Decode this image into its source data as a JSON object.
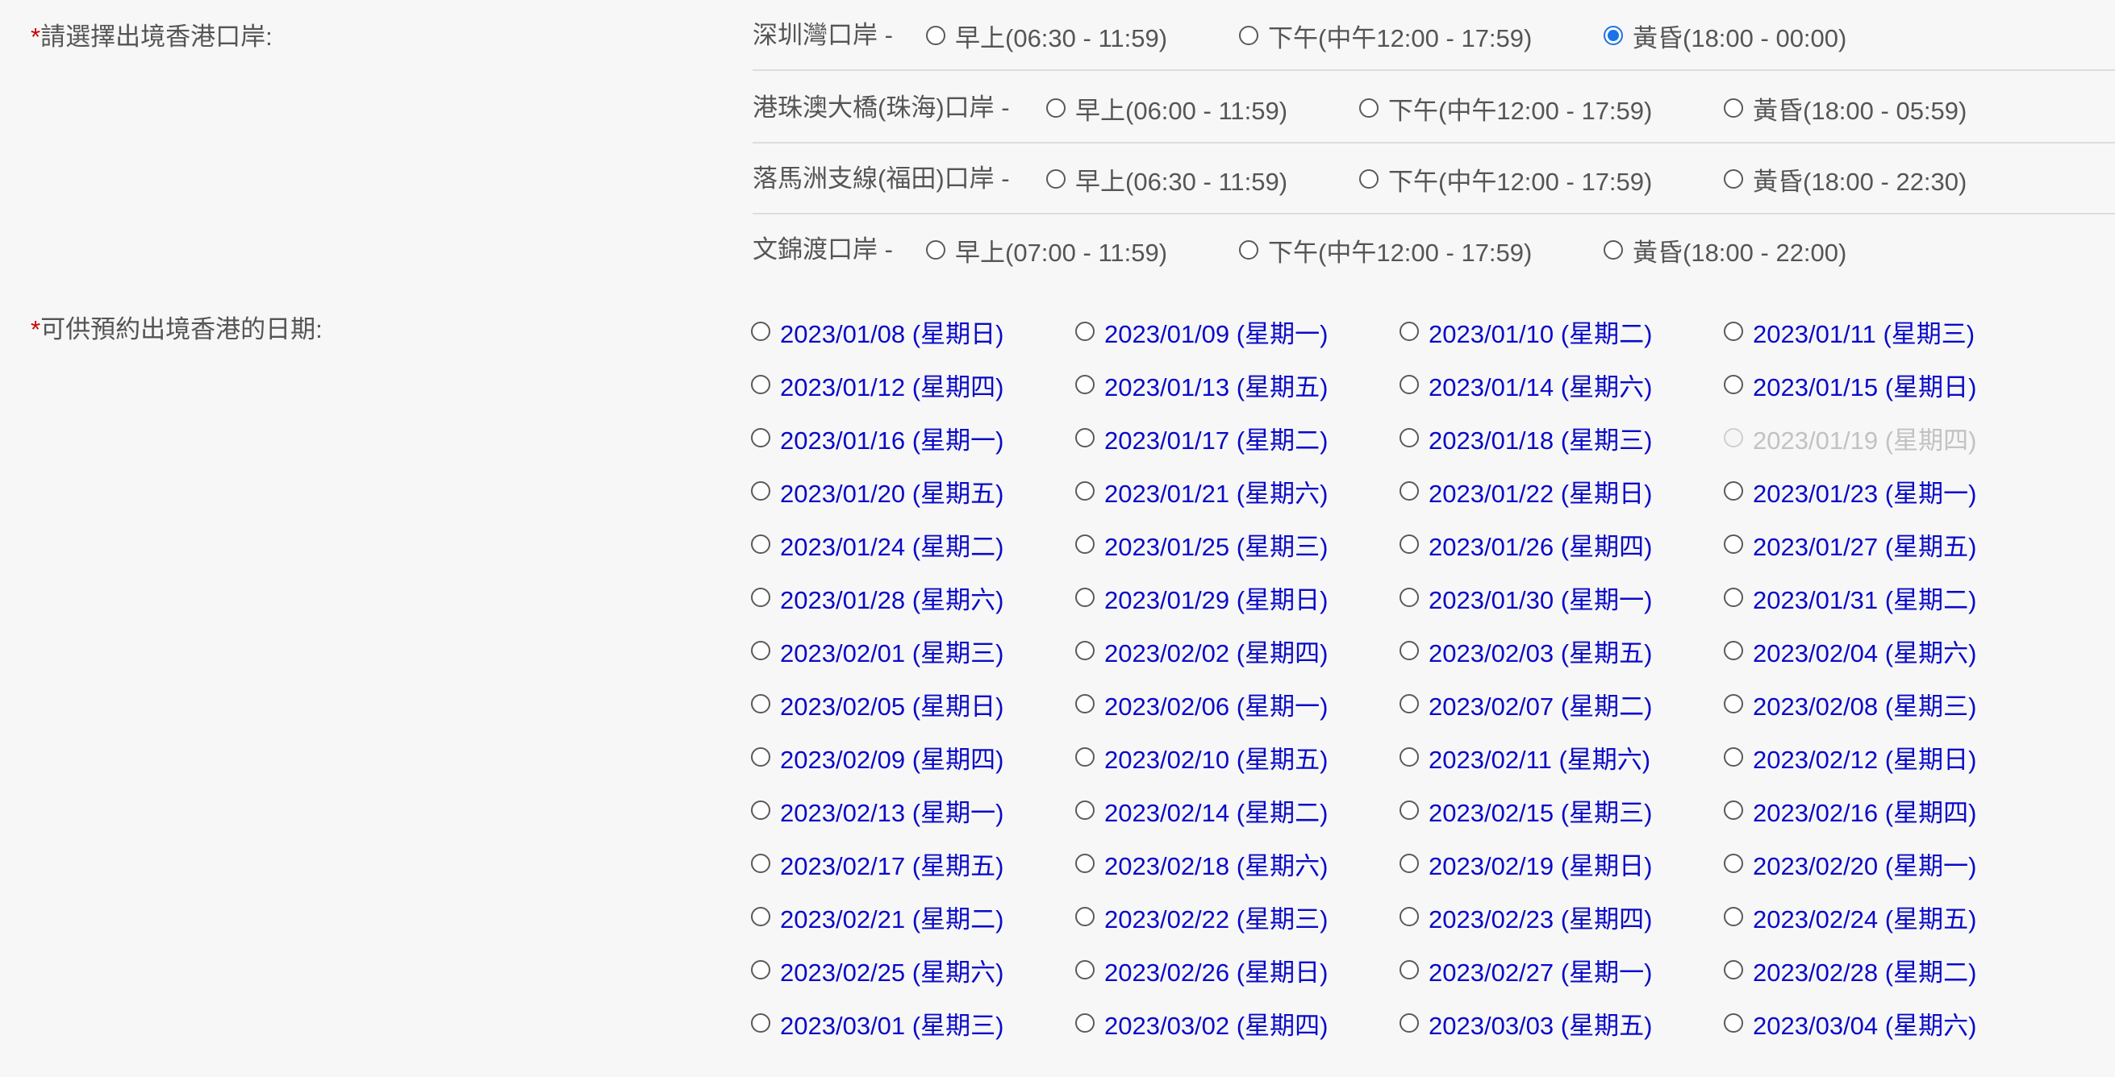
{
  "form": {
    "port_label_required": "*",
    "port_label": "請選擇出境香港口岸:",
    "date_label_required": "*",
    "date_label": "可供預約出境香港的日期:"
  },
  "ports": [
    {
      "name": "深圳灣口岸 -",
      "options": [
        {
          "label": "早上(06:30 - 11:59)",
          "checked": false
        },
        {
          "label": "下午(中午12:00 - 17:59)",
          "checked": false
        },
        {
          "label": "黃昏(18:00 - 00:00)",
          "checked": true
        }
      ]
    },
    {
      "name": "港珠澳大橋(珠海)口岸 -",
      "options": [
        {
          "label": "早上(06:00 - 11:59)",
          "checked": false
        },
        {
          "label": "下午(中午12:00 - 17:59)",
          "checked": false
        },
        {
          "label": "黃昏(18:00 - 05:59)",
          "checked": false
        }
      ]
    },
    {
      "name": "落馬洲支線(福田)口岸 -",
      "options": [
        {
          "label": "早上(06:30 - 11:59)",
          "checked": false
        },
        {
          "label": "下午(中午12:00 - 17:59)",
          "checked": false
        },
        {
          "label": "黃昏(18:00 - 22:30)",
          "checked": false
        }
      ]
    },
    {
      "name": "文錦渡口岸 -",
      "options": [
        {
          "label": "早上(07:00 - 11:59)",
          "checked": false
        },
        {
          "label": "下午(中午12:00 - 17:59)",
          "checked": false
        },
        {
          "label": "黃昏(18:00 - 22:00)",
          "checked": false
        }
      ]
    }
  ],
  "dates": [
    {
      "label": "2023/01/08 (星期日)",
      "disabled": false
    },
    {
      "label": "2023/01/09 (星期一)",
      "disabled": false
    },
    {
      "label": "2023/01/10 (星期二)",
      "disabled": false
    },
    {
      "label": "2023/01/11 (星期三)",
      "disabled": false
    },
    {
      "label": "2023/01/12 (星期四)",
      "disabled": false
    },
    {
      "label": "2023/01/13 (星期五)",
      "disabled": false
    },
    {
      "label": "2023/01/14 (星期六)",
      "disabled": false
    },
    {
      "label": "2023/01/15 (星期日)",
      "disabled": false
    },
    {
      "label": "2023/01/16 (星期一)",
      "disabled": false
    },
    {
      "label": "2023/01/17 (星期二)",
      "disabled": false
    },
    {
      "label": "2023/01/18 (星期三)",
      "disabled": false
    },
    {
      "label": "2023/01/19 (星期四)",
      "disabled": true
    },
    {
      "label": "2023/01/20 (星期五)",
      "disabled": false
    },
    {
      "label": "2023/01/21 (星期六)",
      "disabled": false
    },
    {
      "label": "2023/01/22 (星期日)",
      "disabled": false
    },
    {
      "label": "2023/01/23 (星期一)",
      "disabled": false
    },
    {
      "label": "2023/01/24 (星期二)",
      "disabled": false
    },
    {
      "label": "2023/01/25 (星期三)",
      "disabled": false
    },
    {
      "label": "2023/01/26 (星期四)",
      "disabled": false
    },
    {
      "label": "2023/01/27 (星期五)",
      "disabled": false
    },
    {
      "label": "2023/01/28 (星期六)",
      "disabled": false
    },
    {
      "label": "2023/01/29 (星期日)",
      "disabled": false
    },
    {
      "label": "2023/01/30 (星期一)",
      "disabled": false
    },
    {
      "label": "2023/01/31 (星期二)",
      "disabled": false
    },
    {
      "label": "2023/02/01 (星期三)",
      "disabled": false
    },
    {
      "label": "2023/02/02 (星期四)",
      "disabled": false
    },
    {
      "label": "2023/02/03 (星期五)",
      "disabled": false
    },
    {
      "label": "2023/02/04 (星期六)",
      "disabled": false
    },
    {
      "label": "2023/02/05 (星期日)",
      "disabled": false
    },
    {
      "label": "2023/02/06 (星期一)",
      "disabled": false
    },
    {
      "label": "2023/02/07 (星期二)",
      "disabled": false
    },
    {
      "label": "2023/02/08 (星期三)",
      "disabled": false
    },
    {
      "label": "2023/02/09 (星期四)",
      "disabled": false
    },
    {
      "label": "2023/02/10 (星期五)",
      "disabled": false
    },
    {
      "label": "2023/02/11 (星期六)",
      "disabled": false
    },
    {
      "label": "2023/02/12 (星期日)",
      "disabled": false
    },
    {
      "label": "2023/02/13 (星期一)",
      "disabled": false
    },
    {
      "label": "2023/02/14 (星期二)",
      "disabled": false
    },
    {
      "label": "2023/02/15 (星期三)",
      "disabled": false
    },
    {
      "label": "2023/02/16 (星期四)",
      "disabled": false
    },
    {
      "label": "2023/02/17 (星期五)",
      "disabled": false
    },
    {
      "label": "2023/02/18 (星期六)",
      "disabled": false
    },
    {
      "label": "2023/02/19 (星期日)",
      "disabled": false
    },
    {
      "label": "2023/02/20 (星期一)",
      "disabled": false
    },
    {
      "label": "2023/02/21 (星期二)",
      "disabled": false
    },
    {
      "label": "2023/02/22 (星期三)",
      "disabled": false
    },
    {
      "label": "2023/02/23 (星期四)",
      "disabled": false
    },
    {
      "label": "2023/02/24 (星期五)",
      "disabled": false
    },
    {
      "label": "2023/02/25 (星期六)",
      "disabled": false
    },
    {
      "label": "2023/02/26 (星期日)",
      "disabled": false
    },
    {
      "label": "2023/02/27 (星期一)",
      "disabled": false
    },
    {
      "label": "2023/02/28 (星期二)",
      "disabled": false
    },
    {
      "label": "2023/03/01 (星期三)",
      "disabled": false
    },
    {
      "label": "2023/03/02 (星期四)",
      "disabled": false
    },
    {
      "label": "2023/03/03 (星期五)",
      "disabled": false
    },
    {
      "label": "2023/03/04 (星期六)",
      "disabled": false
    }
  ],
  "colors": {
    "required_star": "#cc0000",
    "link_blue": "#0a0ac8",
    "radio_checked": "#1a73e8",
    "disabled_text": "#c2c2c2"
  }
}
